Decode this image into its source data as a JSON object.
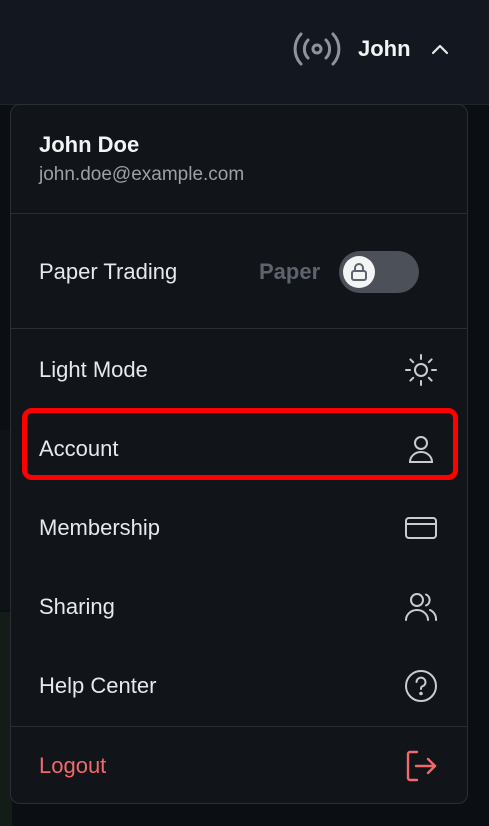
{
  "header": {
    "user_name": "John"
  },
  "menu": {
    "profile": {
      "name": "John Doe",
      "email": "john.doe@example.com"
    },
    "paper_trading": {
      "label": "Paper Trading",
      "mode_text": "Paper",
      "toggle_state": "off"
    },
    "items": [
      {
        "label": "Light Mode",
        "icon": "sun-icon"
      },
      {
        "label": "Account",
        "icon": "user-icon"
      },
      {
        "label": "Membership",
        "icon": "credit-card-icon"
      },
      {
        "label": "Sharing",
        "icon": "users-icon"
      },
      {
        "label": "Help Center",
        "icon": "help-circle-icon"
      }
    ],
    "logout": {
      "label": "Logout",
      "icon": "logout-icon"
    }
  },
  "colors": {
    "background": "#0b0e12",
    "menu_background": "#111418",
    "logout": "#f06a6a",
    "highlight": "#ff0000"
  }
}
